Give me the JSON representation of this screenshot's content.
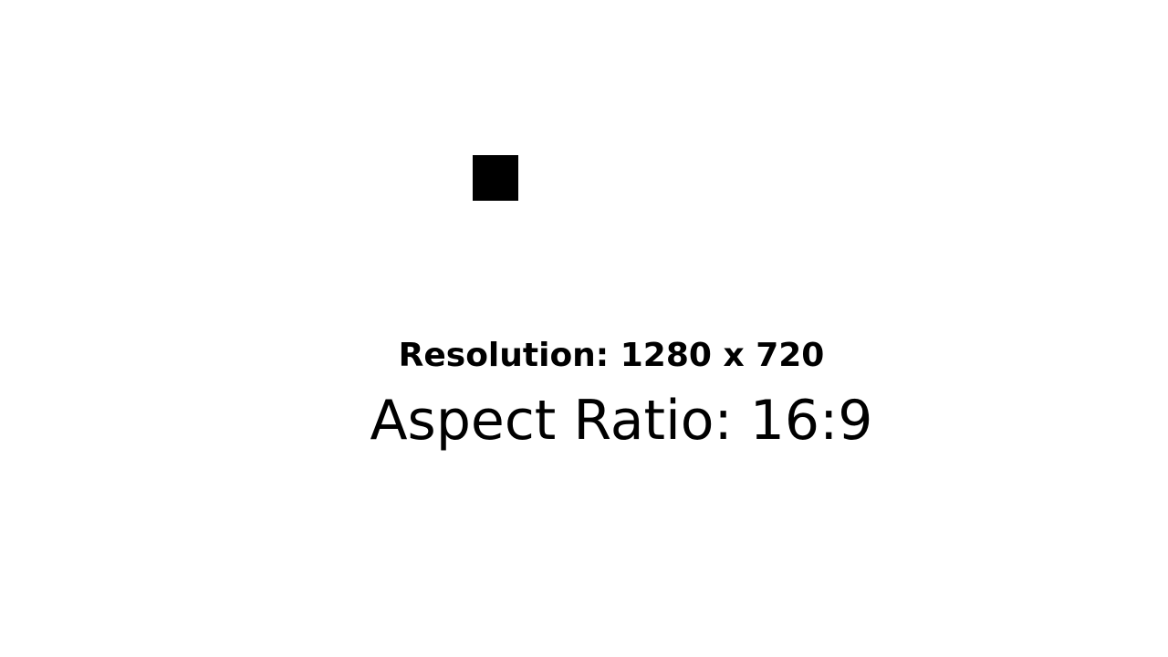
{
  "resolution_text": "Resolution: 1280 x 720",
  "aspect_text": "Aspect Ratio: 16:9",
  "colors": {
    "background": "#ffffff",
    "foreground": "#000000"
  }
}
